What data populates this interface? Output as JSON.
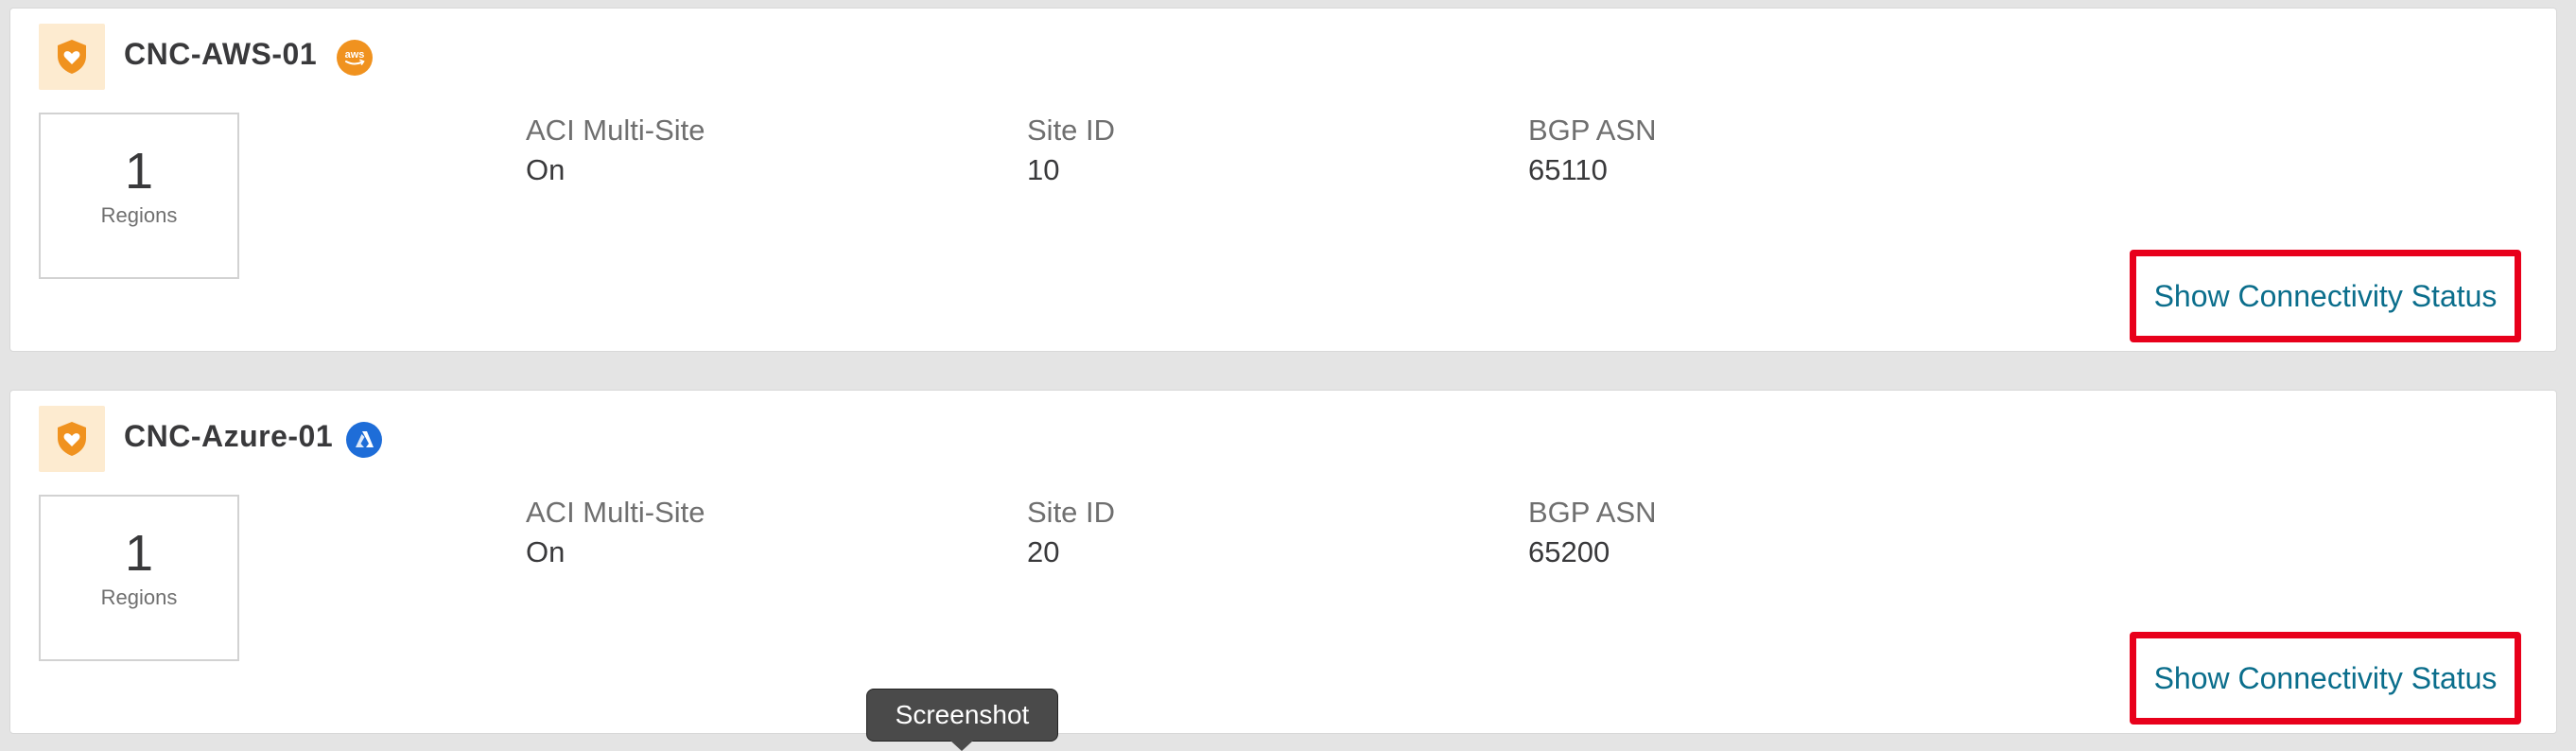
{
  "sites": [
    {
      "name": "CNC-AWS-01",
      "provider_icon": "aws-icon",
      "provider_text": "aws",
      "regions_count": "1",
      "regions_label": "Regions",
      "fields": [
        {
          "label": "ACI Multi-Site",
          "value": "On"
        },
        {
          "label": "Site ID",
          "value": "10"
        },
        {
          "label": "BGP ASN",
          "value": "65110"
        }
      ],
      "connectivity_link": "Show Connectivity Status"
    },
    {
      "name": "CNC-Azure-01",
      "provider_icon": "azure-icon",
      "regions_count": "1",
      "regions_label": "Regions",
      "fields": [
        {
          "label": "ACI Multi-Site",
          "value": "On"
        },
        {
          "label": "Site ID",
          "value": "20"
        },
        {
          "label": "BGP ASN",
          "value": "65200"
        }
      ],
      "connectivity_link": "Show Connectivity Status"
    }
  ],
  "tooltip": {
    "text": "Screenshot"
  },
  "colors": {
    "shield_bg": "#fdebd0",
    "shield": "#f0921f",
    "aws_badge": "#f0921f",
    "azure_badge": "#1e6dd8",
    "highlight": "#e8001b",
    "link": "#0b6e8c"
  }
}
